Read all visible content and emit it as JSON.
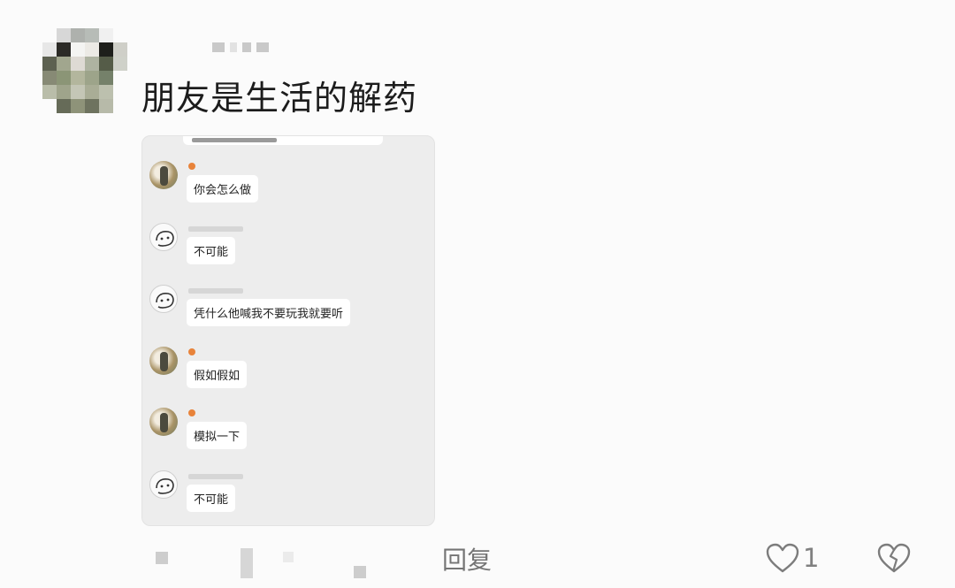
{
  "comment": {
    "text": "朋友是生活的解药",
    "reply_label": "回复",
    "like_count": "1",
    "icons": {
      "like": "heart-outline-icon",
      "dislike": "broken-heart-icon"
    }
  },
  "screenshot": {
    "messages": [
      {
        "sender": "other",
        "text": "你会怎么做"
      },
      {
        "sender": "me",
        "text": "不可能"
      },
      {
        "sender": "me",
        "text": "凭什么他喊我不要玩我就要听"
      },
      {
        "sender": "other",
        "text": "假如假如"
      },
      {
        "sender": "other",
        "text": "模拟一下"
      },
      {
        "sender": "me",
        "text": "不可能"
      }
    ]
  },
  "colors": {
    "background": "#fbfbfb",
    "bubble": "#ffffff",
    "chat_background": "#ededed"
  }
}
